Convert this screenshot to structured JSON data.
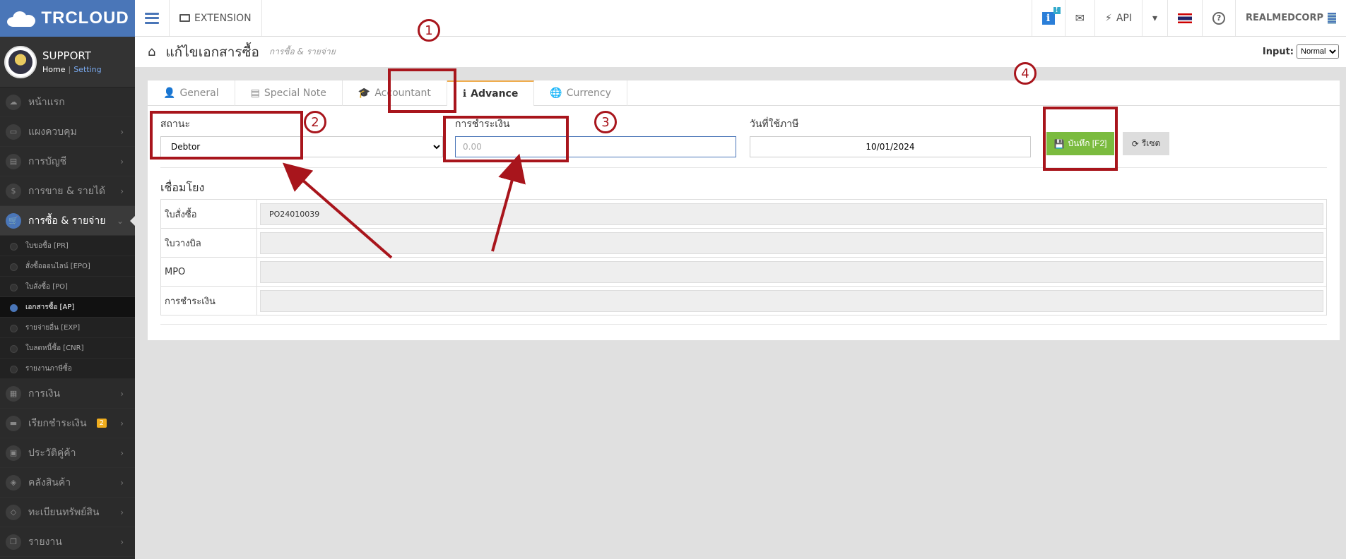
{
  "brand": {
    "logo_text": "TRCLOUD"
  },
  "profile": {
    "name": "SUPPORT",
    "home_link": "Home",
    "setting_link": "Setting"
  },
  "sidebar": {
    "items": [
      {
        "label": "หน้าแรก",
        "icon": "cloud-icon"
      },
      {
        "label": "แผงควบคุม",
        "icon": "monitor-icon"
      },
      {
        "label": "การบัญชี",
        "icon": "book-icon"
      },
      {
        "label": "การขาย & รายได้",
        "icon": "dollar-icon"
      },
      {
        "label": "การซื้อ & รายจ่าย",
        "icon": "cart-icon"
      },
      {
        "label": "การเงิน",
        "icon": "calendar-icon"
      },
      {
        "label": "เรียกชำระเงิน",
        "icon": "card-icon",
        "badge": "2"
      },
      {
        "label": "ประวัติคู่ค้า",
        "icon": "contact-icon"
      },
      {
        "label": "คลังสินค้า",
        "icon": "cubes-icon"
      },
      {
        "label": "ทะเบียนทรัพย์สิน",
        "icon": "diamond-icon"
      },
      {
        "label": "รายงาน",
        "icon": "copy-icon"
      }
    ],
    "sub_items": [
      "ใบขอซื้อ [PR]",
      "สั่งซื้อออนไลน์ [EPO]",
      "ใบสั่งซื้อ [PO]",
      "เอกสารซื้อ [AP]",
      "รายจ่ายอื่น [EXP]",
      "ใบลดหนี้ซื้อ [CNR]",
      "รายงานภาษีซื้อ"
    ]
  },
  "topbar": {
    "extension_label": "EXTENSION",
    "info_badge": "!",
    "api_label": "API",
    "company": "REALMEDCORP"
  },
  "page": {
    "title": "แก้ไขเอกสารซื้อ",
    "subtitle": "การซื้อ & รายจ่าย",
    "input_label": "Input:",
    "input_mode": "Normal"
  },
  "tabs": [
    {
      "label": "General",
      "icon": "user-icon"
    },
    {
      "label": "Special Note",
      "icon": "note-icon"
    },
    {
      "label": "Accountant",
      "icon": "graduation-icon"
    },
    {
      "label": "Advance",
      "icon": "info-square-icon"
    },
    {
      "label": "Currency",
      "icon": "globe-icon"
    }
  ],
  "form": {
    "status_label": "สถานะ",
    "status_value": "Debtor",
    "payment_label": "การชำระเงิน",
    "payment_placeholder": "0.00",
    "tax_date_label": "วันที่ใช้ภาษี",
    "tax_date_value": "10/01/2024",
    "save_label": "บันทึก [F2]",
    "reset_label": "รีเซต"
  },
  "links": {
    "title": "เชื่อมโยง",
    "rows": [
      {
        "label": "ใบสั่งซื้อ",
        "value": "PO24010039"
      },
      {
        "label": "ใบวางบิล",
        "value": ""
      },
      {
        "label": "MPO",
        "value": ""
      },
      {
        "label": "การชำระเงิน",
        "value": ""
      }
    ]
  },
  "annotations": [
    "1",
    "2",
    "3",
    "4"
  ],
  "colors": {
    "brand": "#4a76b8",
    "annotation": "#a8151c",
    "save": "#7bbb3f",
    "tab_accent": "#f0ad4e"
  }
}
